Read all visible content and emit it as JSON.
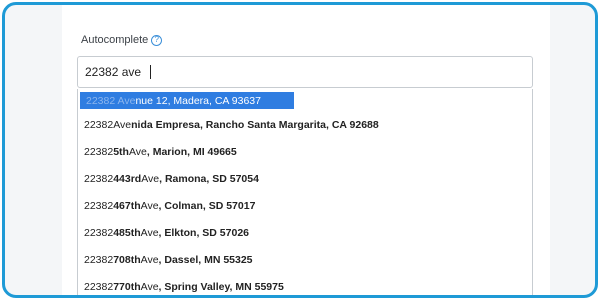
{
  "field": {
    "label": "Autocomplete",
    "help_icon": "question-circle-icon",
    "value": "22382 ave"
  },
  "selected_option": {
    "match": "22382 Ave",
    "rest": "nue 12, Madera, CA 93637"
  },
  "options": [
    {
      "prefix": "22382 ",
      "m1": "Ave",
      "b1": "nida Empresa, Rancho Santa Margarita, CA 92688"
    },
    {
      "prefix": "22382 ",
      "b0": "5th ",
      "m1": "Ave",
      "b1": ", Marion, MI 49665"
    },
    {
      "prefix": "22382 ",
      "b0": "443rd ",
      "m1": "Ave",
      "b1": ", Ramona, SD 57054"
    },
    {
      "prefix": "22382 ",
      "b0": "467th ",
      "m1": "Ave",
      "b1": ", Colman, SD 57017"
    },
    {
      "prefix": "22382 ",
      "b0": "485th ",
      "m1": "Ave",
      "b1": ", Elkton, SD 57026"
    },
    {
      "prefix": "22382 ",
      "b0": "708th ",
      "m1": "Ave",
      "b1": ", Dassel, MN 55325"
    },
    {
      "prefix": "22382 ",
      "b0": "770th ",
      "m1": "Ave",
      "b1": ", Spring Valley, MN 55975"
    }
  ],
  "colors": {
    "frame_border": "#1e9ad6",
    "selection": "#2f7de1",
    "help_icon": "#3b8fd9"
  }
}
